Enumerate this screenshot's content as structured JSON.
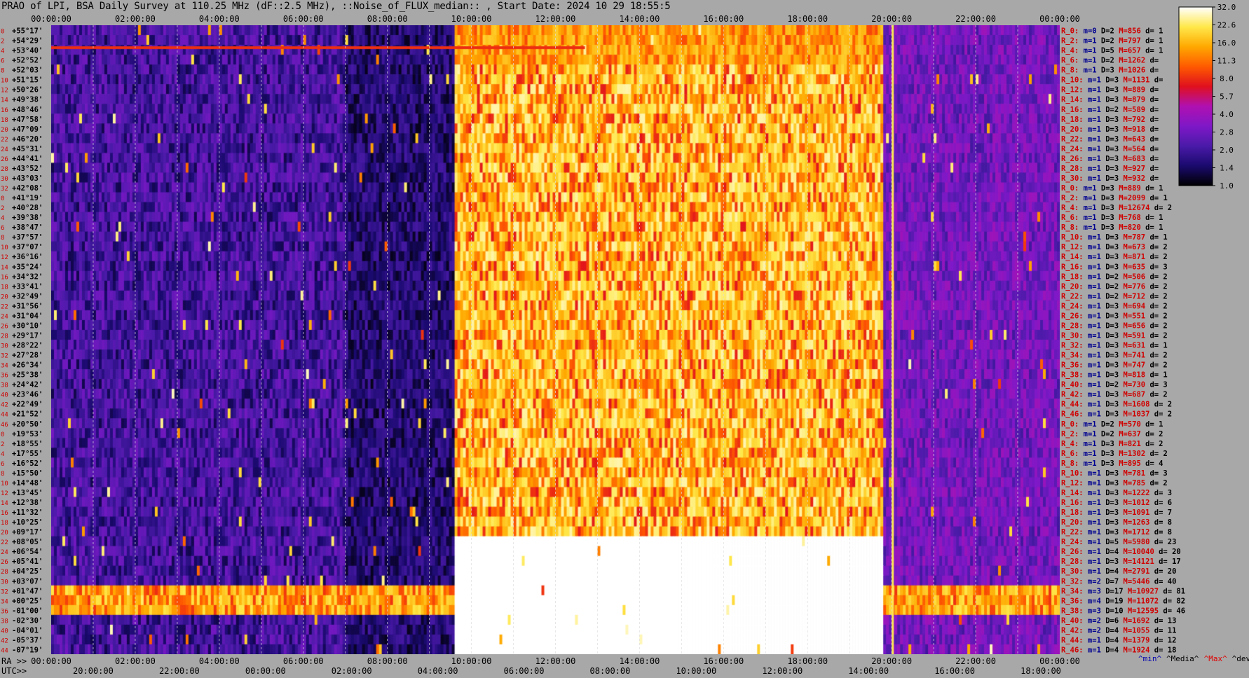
{
  "title": "PRAO of LPI, BSA Daily Survey at 110.25 MHz (dF::2.5 MHz), ::Noise_of_FLUX_median:: , Start Date: 2024 10 29 18:55:5",
  "bottom_labels": {
    "ra": "RA >>",
    "utc": "UTC>>"
  },
  "legend_keys": [
    {
      "text": "^min^",
      "color": "#0000b0"
    },
    {
      "text": "^Media^",
      "color": "#000000"
    },
    {
      "text": "^Max^",
      "color": "#e00000"
    },
    {
      "text": "^devia^",
      "color": "#000000"
    }
  ],
  "colorbar": {
    "ticks": [
      "32.0",
      "22.6",
      "16.0",
      "11.3",
      "8.0",
      "5.7",
      "4.0",
      "2.8",
      "2.0",
      "1.4",
      "1.0"
    ],
    "scale": "log",
    "colormap": [
      "#000000",
      "#1a0a6e",
      "#4a1aa8",
      "#7f18c8",
      "#b010b0",
      "#e0101e",
      "#ff5a00",
      "#ffa800",
      "#ffe84a",
      "#ffffff"
    ]
  },
  "chart_data": {
    "type": "heatmap",
    "x_top_labels": [
      "00:00:00",
      "02:00:00",
      "04:00:00",
      "06:00:00",
      "08:00:00",
      "10:00:00",
      "12:00:00",
      "14:00:00",
      "16:00:00",
      "18:00:00",
      "20:00:00",
      "22:00:00",
      "00:00:00"
    ],
    "x_bottom_ra_labels": [
      "00:00:00",
      "02:00:00",
      "04:00:00",
      "06:00:00",
      "08:00:00",
      "10:00:00",
      "12:00:00",
      "14:00:00",
      "16:00:00",
      "18:00:00",
      "20:00:00",
      "22:00:00",
      "00:00:00"
    ],
    "x_bottom_utc_labels": [
      "20:00:00",
      "22:00:00",
      "00:00:00",
      "02:00:00",
      "04:00:00",
      "06:00:00",
      "08:00:00",
      "10:00:00",
      "12:00:00",
      "14:00:00",
      "16:00:00",
      "18:00:00"
    ],
    "row_index_labels": [
      "0",
      "2",
      "4",
      "6",
      "8",
      "10",
      "12",
      "14",
      "16",
      "18",
      "20",
      "22",
      "24",
      "26",
      "28",
      "30",
      "32",
      "0",
      "2",
      "4",
      "6",
      "8",
      "10",
      "12",
      "14",
      "16",
      "18",
      "20",
      "22",
      "24",
      "26",
      "28",
      "30",
      "32",
      "34",
      "36",
      "38",
      "40",
      "42",
      "44",
      "46",
      "0",
      "2",
      "4",
      "6",
      "8",
      "10",
      "12",
      "14",
      "16",
      "18",
      "20",
      "22",
      "24",
      "26",
      "28",
      "30",
      "32",
      "34",
      "36",
      "38",
      "40",
      "42",
      "44",
      "46"
    ],
    "declinations": [
      "+55°17'",
      "+54°29'",
      "+53°40'",
      "+52°52'",
      "+52°03'",
      "+51°15'",
      "+50°26'",
      "+49°38'",
      "+48°46'",
      "+47°58'",
      "+47°09'",
      "+46°20'",
      "+45°31'",
      "+44°41'",
      "+43°52'",
      "+43°03'",
      "+42°08'",
      "+41°19'",
      "+40°28'",
      "+39°38'",
      "+38°47'",
      "+37°57'",
      "+37°07'",
      "+36°16'",
      "+35°24'",
      "+34°32'",
      "+33°41'",
      "+32°49'",
      "+31°56'",
      "+31°04'",
      "+30°10'",
      "+29°17'",
      "+28°22'",
      "+27°28'",
      "+26°34'",
      "+25°38'",
      "+24°42'",
      "+23°46'",
      "+22°49'",
      "+21°52'",
      "+20°50'",
      "+19°53'",
      "+18°55'",
      "+17°55'",
      "+16°52'",
      "+15°50'",
      "+14°48'",
      "+13°45'",
      "+12°38'",
      "+11°32'",
      "+10°25'",
      "+09°17'",
      "+08°05'",
      "+06°54'",
      "+05°41'",
      "+04°25'",
      "+03°07'",
      "+01°47'",
      "+00°25'",
      "-01°00'",
      "-02°30'",
      "-04°01'",
      "-05°37'",
      "-07°19'"
    ],
    "rows": [
      {
        "beam": "R_0:",
        "m": "m=0",
        "D": "D=2",
        "M": "M=856",
        "d": "d= 1"
      },
      {
        "beam": "R_2:",
        "m": "m=1",
        "D": "D=2",
        "M": "M=797",
        "d": "d= 1"
      },
      {
        "beam": "R_4:",
        "m": "m=1",
        "D": "D=5",
        "M": "M=657",
        "d": "d= 1"
      },
      {
        "beam": "R_6:",
        "m": "m=1",
        "D": "D=2",
        "M": "M=1262",
        "d": "d="
      },
      {
        "beam": "R_8:",
        "m": "m=1",
        "D": "D=3",
        "M": "M=1026",
        "d": "d="
      },
      {
        "beam": "R_10:",
        "m": "m=1",
        "D": "D=3",
        "M": "M=1131",
        "d": "d="
      },
      {
        "beam": "R_12:",
        "m": "m=1",
        "D": "D=3",
        "M": "M=889",
        "d": "d="
      },
      {
        "beam": "R_14:",
        "m": "m=1",
        "D": "D=3",
        "M": "M=879",
        "d": "d="
      },
      {
        "beam": "R_16:",
        "m": "m=1",
        "D": "D=2",
        "M": "M=589",
        "d": "d="
      },
      {
        "beam": "R_18:",
        "m": "m=1",
        "D": "D=3",
        "M": "M=792",
        "d": "d="
      },
      {
        "beam": "R_20:",
        "m": "m=1",
        "D": "D=3",
        "M": "M=918",
        "d": "d="
      },
      {
        "beam": "R_22:",
        "m": "m=1",
        "D": "D=3",
        "M": "M=643",
        "d": "d="
      },
      {
        "beam": "R_24:",
        "m": "m=1",
        "D": "D=3",
        "M": "M=564",
        "d": "d="
      },
      {
        "beam": "R_26:",
        "m": "m=1",
        "D": "D=3",
        "M": "M=683",
        "d": "d="
      },
      {
        "beam": "R_28:",
        "m": "m=1",
        "D": "D=3",
        "M": "M=927",
        "d": "d="
      },
      {
        "beam": "R_30:",
        "m": "m=1",
        "D": "D=3",
        "M": "M=932",
        "d": "d="
      },
      {
        "beam": "R_0:",
        "m": "m=1",
        "D": "D=3",
        "M": "M=889",
        "d": "d= 1"
      },
      {
        "beam": "R_2:",
        "m": "m=1",
        "D": "D=3",
        "M": "M=2099",
        "d": "d= 1"
      },
      {
        "beam": "R_4:",
        "m": "m=1",
        "D": "D=3",
        "M": "M=12674",
        "d": "d= 2"
      },
      {
        "beam": "R_6:",
        "m": "m=1",
        "D": "D=3",
        "M": "M=768",
        "d": "d= 1"
      },
      {
        "beam": "R_8:",
        "m": "m=1",
        "D": "D=3",
        "M": "M=820",
        "d": "d= 1"
      },
      {
        "beam": "R_10:",
        "m": "m=1",
        "D": "D=3",
        "M": "M=787",
        "d": "d= 1"
      },
      {
        "beam": "R_12:",
        "m": "m=1",
        "D": "D=3",
        "M": "M=673",
        "d": "d= 2"
      },
      {
        "beam": "R_14:",
        "m": "m=1",
        "D": "D=3",
        "M": "M=871",
        "d": "d= 2"
      },
      {
        "beam": "R_16:",
        "m": "m=1",
        "D": "D=3",
        "M": "M=635",
        "d": "d= 3"
      },
      {
        "beam": "R_18:",
        "m": "m=1",
        "D": "D=2",
        "M": "M=506",
        "d": "d= 2"
      },
      {
        "beam": "R_20:",
        "m": "m=1",
        "D": "D=2",
        "M": "M=776",
        "d": "d= 2"
      },
      {
        "beam": "R_22:",
        "m": "m=1",
        "D": "D=2",
        "M": "M=712",
        "d": "d= 2"
      },
      {
        "beam": "R_24:",
        "m": "m=1",
        "D": "D=3",
        "M": "M=694",
        "d": "d= 2"
      },
      {
        "beam": "R_26:",
        "m": "m=1",
        "D": "D=3",
        "M": "M=551",
        "d": "d= 2"
      },
      {
        "beam": "R_28:",
        "m": "m=1",
        "D": "D=3",
        "M": "M=656",
        "d": "d= 2"
      },
      {
        "beam": "R_30:",
        "m": "m=1",
        "D": "D=3",
        "M": "M=591",
        "d": "d= 2"
      },
      {
        "beam": "R_32:",
        "m": "m=1",
        "D": "D=3",
        "M": "M=631",
        "d": "d= 1"
      },
      {
        "beam": "R_34:",
        "m": "m=1",
        "D": "D=3",
        "M": "M=741",
        "d": "d= 2"
      },
      {
        "beam": "R_36:",
        "m": "m=1",
        "D": "D=3",
        "M": "M=747",
        "d": "d= 2"
      },
      {
        "beam": "R_38:",
        "m": "m=1",
        "D": "D=3",
        "M": "M=818",
        "d": "d= 1"
      },
      {
        "beam": "R_40:",
        "m": "m=1",
        "D": "D=2",
        "M": "M=730",
        "d": "d= 3"
      },
      {
        "beam": "R_42:",
        "m": "m=1",
        "D": "D=3",
        "M": "M=687",
        "d": "d= 2"
      },
      {
        "beam": "R_44:",
        "m": "m=1",
        "D": "D=3",
        "M": "M=1608",
        "d": "d= 2"
      },
      {
        "beam": "R_46:",
        "m": "m=1",
        "D": "D=3",
        "M": "M=1037",
        "d": "d= 2"
      },
      {
        "beam": "R_0:",
        "m": "m=1",
        "D": "D=2",
        "M": "M=570",
        "d": "d= 1"
      },
      {
        "beam": "R_2:",
        "m": "m=1",
        "D": "D=2",
        "M": "M=637",
        "d": "d= 2"
      },
      {
        "beam": "R_4:",
        "m": "m=1",
        "D": "D=3",
        "M": "M=821",
        "d": "d= 2"
      },
      {
        "beam": "R_6:",
        "m": "m=1",
        "D": "D=3",
        "M": "M=1302",
        "d": "d= 2"
      },
      {
        "beam": "R_8:",
        "m": "m=1",
        "D": "D=3",
        "M": "M=895",
        "d": "d= 4"
      },
      {
        "beam": "R_10:",
        "m": "m=1",
        "D": "D=3",
        "M": "M=781",
        "d": "d= 3"
      },
      {
        "beam": "R_12:",
        "m": "m=1",
        "D": "D=3",
        "M": "M=785",
        "d": "d= 2"
      },
      {
        "beam": "R_14:",
        "m": "m=1",
        "D": "D=3",
        "M": "M=1222",
        "d": "d= 3"
      },
      {
        "beam": "R_16:",
        "m": "m=1",
        "D": "D=3",
        "M": "M=1012",
        "d": "d= 6"
      },
      {
        "beam": "R_18:",
        "m": "m=1",
        "D": "D=3",
        "M": "M=1091",
        "d": "d= 7"
      },
      {
        "beam": "R_20:",
        "m": "m=1",
        "D": "D=3",
        "M": "M=1263",
        "d": "d= 8"
      },
      {
        "beam": "R_22:",
        "m": "m=1",
        "D": "D=3",
        "M": "M=1712",
        "d": "d= 8"
      },
      {
        "beam": "R_24:",
        "m": "m=1",
        "D": "D=5",
        "M": "M=5980",
        "d": "d= 23"
      },
      {
        "beam": "R_26:",
        "m": "m=1",
        "D": "D=4",
        "M": "M=10040",
        "d": "d= 20"
      },
      {
        "beam": "R_28:",
        "m": "m=1",
        "D": "D=3",
        "M": "M=14121",
        "d": "d= 17"
      },
      {
        "beam": "R_30:",
        "m": "m=1",
        "D": "D=4",
        "M": "M=2791",
        "d": "d= 20"
      },
      {
        "beam": "R_32:",
        "m": "m=2",
        "D": "D=7",
        "M": "M=5446",
        "d": "d= 40"
      },
      {
        "beam": "R_34:",
        "m": "m=3",
        "D": "D=17",
        "M": "M=10927",
        "d": "d= 81"
      },
      {
        "beam": "R_36:",
        "m": "m=4",
        "D": "D=19",
        "M": "M=11072",
        "d": "d= 82"
      },
      {
        "beam": "R_38:",
        "m": "m=3",
        "D": "D=10",
        "M": "M=12595",
        "d": "d= 46"
      },
      {
        "beam": "R_40:",
        "m": "m=2",
        "D": "D=6",
        "M": "M=1692",
        "d": "d= 13"
      },
      {
        "beam": "R_42:",
        "m": "m=2",
        "D": "D=4",
        "M": "M=1055",
        "d": "d= 11"
      },
      {
        "beam": "R_44:",
        "m": "m=1",
        "D": "D=4",
        "M": "M=1379",
        "d": "d= 12"
      },
      {
        "beam": "R_46:",
        "m": "m=1",
        "D": "D=4",
        "M": "M=1924",
        "d": "d= 18"
      }
    ],
    "x_range_hours": [
      0,
      24
    ],
    "intensity_range": [
      1.0,
      32.0
    ],
    "bright_region_hours": [
      9.6,
      19.8
    ]
  }
}
